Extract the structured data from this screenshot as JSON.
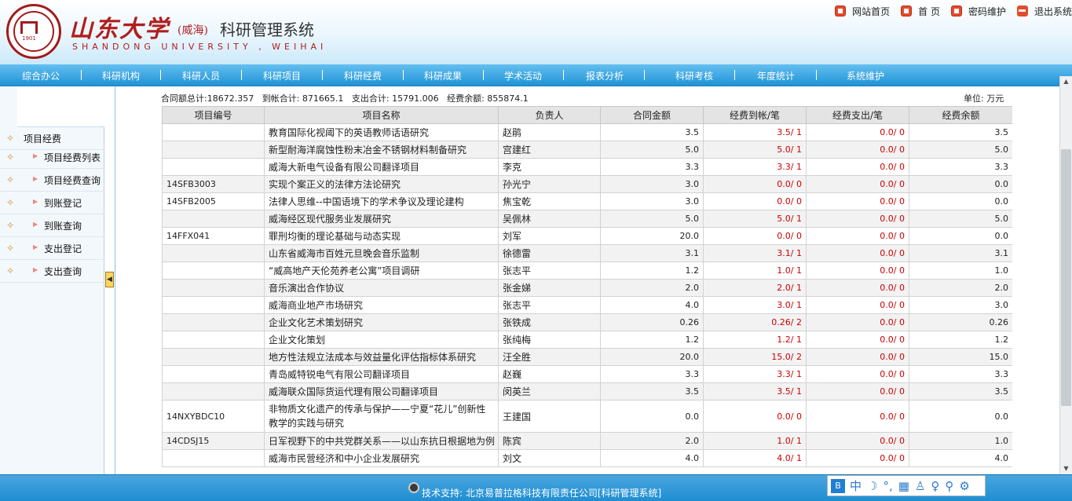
{
  "header": {
    "logo_year": "1901",
    "title_cn": "山东大学",
    "campus": "(威海)",
    "system_name": "科研管理系统",
    "title_en": "SHANDONG UNIVERSITY , WEIHAI"
  },
  "top_links": [
    "网站首页",
    "首 页",
    "密码维护",
    "退出系统"
  ],
  "nav": [
    "综合办公",
    "科研机构",
    "科研人员",
    "科研项目",
    "科研经费",
    "科研成果",
    "学术活动",
    "报表分析",
    "科研考核",
    "年度统计",
    "系统维护"
  ],
  "sidebar": {
    "items": [
      {
        "label": "项目经费",
        "level": 0
      },
      {
        "label": "项目经费列表",
        "level": 1
      },
      {
        "label": "项目经费查询",
        "level": 1
      },
      {
        "label": "到账登记",
        "level": 1
      },
      {
        "label": "到账查询",
        "level": 1
      },
      {
        "label": "支出登记",
        "level": 1
      },
      {
        "label": "支出查询",
        "level": 1
      }
    ]
  },
  "summary": {
    "contract_total": "合同额总计:18672.357",
    "received_total": "到帐合计: 871665.1",
    "expense_total": "支出合计: 15791.006",
    "balance": "经费余额: 855874.1",
    "unit": "单位: 万元"
  },
  "table": {
    "headers": [
      "项目编号",
      "项目名称",
      "负责人",
      "合同金额",
      "经费到帐/笔",
      "经费支出/笔",
      "经费余额"
    ],
    "rows": [
      {
        "code": "",
        "name": "教育国际化视阈下的英语教师话语研究",
        "person": "赵鹃",
        "contract": "3.5",
        "received": "3.5/ 1",
        "expense": "0.0/ 0",
        "balance": "3.5"
      },
      {
        "code": "",
        "name": "新型耐海洋腐蚀性粉末冶金不锈钢材料制备研究",
        "person": "宫建红",
        "contract": "5.0",
        "received": "5.0/ 1",
        "expense": "0.0/ 0",
        "balance": "5.0"
      },
      {
        "code": "",
        "name": "威海大新电气设备有限公司翻译项目",
        "person": "李克",
        "contract": "3.3",
        "received": "3.3/ 1",
        "expense": "0.0/ 0",
        "balance": "3.3"
      },
      {
        "code": "14SFB3003",
        "name": "实现个案正义的法律方法论研究",
        "person": "孙光宁",
        "contract": "3.0",
        "received": "0.0/ 0",
        "expense": "0.0/ 0",
        "balance": "0.0"
      },
      {
        "code": "14SFB2005",
        "name": "法律人思维--中国语境下的学术争议及理论建构",
        "person": "焦宝乾",
        "contract": "3.0",
        "received": "0.0/ 0",
        "expense": "0.0/ 0",
        "balance": "0.0"
      },
      {
        "code": "",
        "name": "威海经区现代服务业发展研究",
        "person": "吴佩林",
        "contract": "5.0",
        "received": "5.0/ 1",
        "expense": "0.0/ 0",
        "balance": "5.0"
      },
      {
        "code": "14FFX041",
        "name": "罪刑均衡的理论基础与动态实现",
        "person": "刘军",
        "contract": "20.0",
        "received": "0.0/ 0",
        "expense": "0.0/ 0",
        "balance": "0.0"
      },
      {
        "code": "",
        "name": "山东省威海市百姓元旦晚会音乐监制",
        "person": "徐德雷",
        "contract": "3.1",
        "received": "3.1/ 1",
        "expense": "0.0/ 0",
        "balance": "3.1"
      },
      {
        "code": "",
        "name": "“威高地产天伦苑养老公寓”项目调研",
        "person": "张志平",
        "contract": "1.2",
        "received": "1.0/ 1",
        "expense": "0.0/ 0",
        "balance": "1.0"
      },
      {
        "code": "",
        "name": "音乐演出合作协议",
        "person": "张金娣",
        "contract": "2.0",
        "received": "2.0/ 1",
        "expense": "0.0/ 0",
        "balance": "2.0"
      },
      {
        "code": "",
        "name": "威海商业地产市场研究",
        "person": "张志平",
        "contract": "4.0",
        "received": "3.0/ 1",
        "expense": "0.0/ 0",
        "balance": "3.0"
      },
      {
        "code": "",
        "name": "企业文化艺术策划研究",
        "person": "张铁成",
        "contract": "0.26",
        "received": "0.26/ 2",
        "expense": "0.0/ 0",
        "balance": "0.26"
      },
      {
        "code": "",
        "name": "企业文化策划",
        "person": "张纯梅",
        "contract": "1.2",
        "received": "1.2/ 1",
        "expense": "0.0/ 0",
        "balance": "1.2"
      },
      {
        "code": "",
        "name": "地方性法规立法成本与效益量化评估指标体系研究",
        "person": "汪全胜",
        "contract": "20.0",
        "received": "15.0/ 2",
        "expense": "0.0/ 0",
        "balance": "15.0"
      },
      {
        "code": "",
        "name": "青岛威特锐电气有限公司翻译项目",
        "person": "赵巍",
        "contract": "3.3",
        "received": "3.3/ 1",
        "expense": "0.0/ 0",
        "balance": "3.3"
      },
      {
        "code": "",
        "name": "威海联众国际货运代理有限公司翻译项目",
        "person": "闵英兰",
        "contract": "3.5",
        "received": "3.5/ 1",
        "expense": "0.0/ 0",
        "balance": "3.5"
      },
      {
        "code": "14NXYBDC10",
        "name": "非物质文化遗产的传承与保护——宁夏“花儿”创新性教学的实践与研究",
        "person": "王建国",
        "contract": "0.0",
        "received": "0.0/ 0",
        "expense": "0.0/ 0",
        "balance": "0.0"
      },
      {
        "code": "14CDSJ15",
        "name": "日军视野下的中共党群关系——以山东抗日根据地为例",
        "person": "陈宾",
        "contract": "2.0",
        "received": "1.0/ 1",
        "expense": "0.0/ 0",
        "balance": "1.0"
      },
      {
        "code": "",
        "name": "威海市民营经济和中小企业发展研究",
        "person": "刘文",
        "contract": "4.0",
        "received": "4.0/ 1",
        "expense": "0.0/ 0",
        "balance": "4.0"
      }
    ]
  },
  "footer": {
    "text": "技术支持: 北京易普拉格科技有限责任公司[科研管理系统]"
  },
  "ime": {
    "label": "中"
  }
}
